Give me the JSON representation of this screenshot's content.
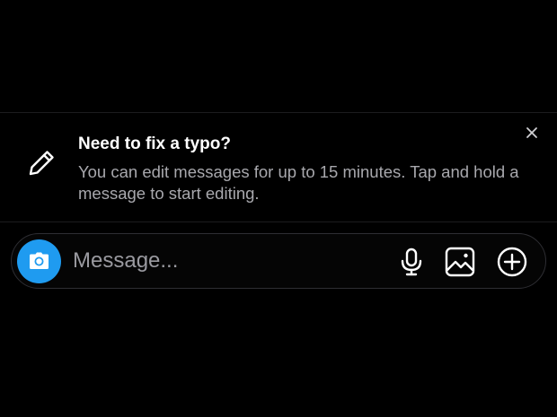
{
  "tip": {
    "title": "Need to fix a typo?",
    "body": "You can edit messages for up to 15 minutes. Tap and hold a message to start editing.",
    "icon": "pencil-icon",
    "close_icon": "close-icon"
  },
  "composer": {
    "placeholder": "Message...",
    "camera_icon": "camera-icon",
    "actions": [
      "microphone-icon",
      "gallery-icon",
      "add-circle-icon"
    ]
  },
  "colors": {
    "background": "#000000",
    "accent": "#1f9bf0",
    "secondary_text": "#a8a8ad",
    "placeholder": "#9a9aa0",
    "border": "#2e2e33"
  }
}
